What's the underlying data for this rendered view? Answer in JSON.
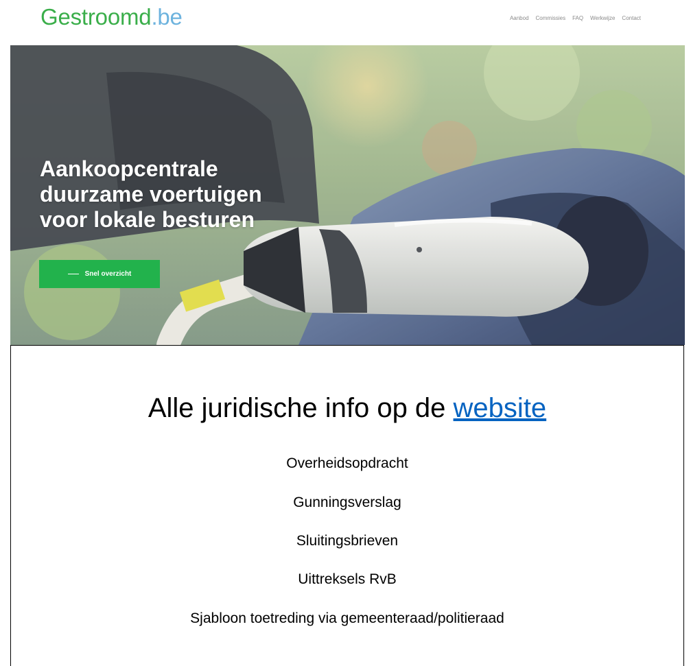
{
  "header": {
    "logo_main": "Gestroomd",
    "logo_tld": ".be",
    "nav": [
      "Aanbod",
      "Commissies",
      "FAQ",
      "Werkwijze",
      "Contact"
    ]
  },
  "hero": {
    "title_lines": [
      "Aankoopcentrale",
      "duurzame voertuigen",
      "voor lokale besturen"
    ],
    "cta_label": "Snel overzicht",
    "image": "ev-charging-plug-in-car"
  },
  "info": {
    "title_prefix": "Alle juridische info op de ",
    "title_link": "website",
    "documents": [
      "Overheidsopdracht",
      "Gunningsverslag",
      "Sluitingsbrieven",
      "Uittreksels RvB",
      "Sjabloon toetreding via gemeenteraad/politieraad"
    ]
  },
  "colors": {
    "brand_green": "#3aae4a",
    "brand_blue": "#6db3de",
    "cta_green": "#22b24c",
    "link_blue": "#0563c1"
  }
}
